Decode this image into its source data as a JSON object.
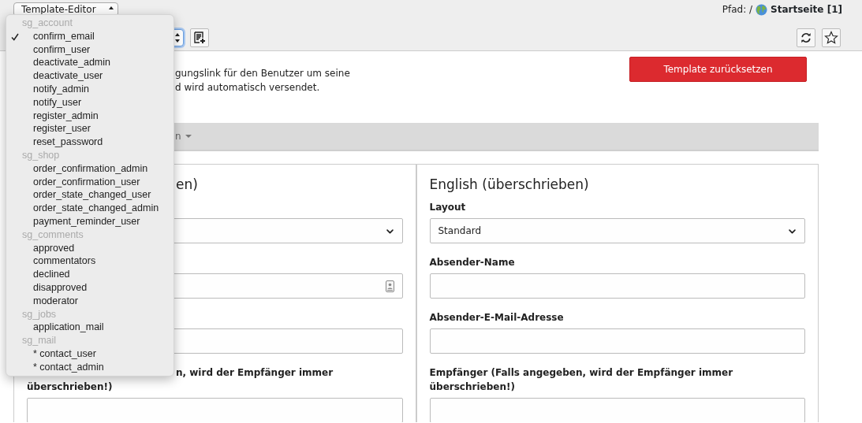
{
  "editor_select": {
    "value": "Template-Editor"
  },
  "path": {
    "label": "Pfad: /",
    "page": "Startseite [1]"
  },
  "reset_button": {
    "label": "Template zurücksetzen"
  },
  "description_lines": [
    "gungslink für den Benutzer um seine",
    "d wird automatisch versendet."
  ],
  "language_tab": {
    "label": "n"
  },
  "columns": [
    {
      "heading": "en)",
      "fields": [
        {
          "kind": "select"
        },
        {
          "kind": "picker"
        },
        {
          "kind": "text"
        },
        {
          "kind": "text",
          "label_lines": [
            "n, wird der Empfänger immer",
            "überschrieben!)"
          ]
        }
      ]
    },
    {
      "heading": "English (überschrieben)",
      "fields": [
        {
          "kind": "select",
          "label": "Layout",
          "value": "Standard"
        },
        {
          "kind": "text",
          "label": "Absender-Name"
        },
        {
          "kind": "text",
          "label": "Absender-E-Mail-Adresse"
        },
        {
          "kind": "text",
          "label": "Empfänger (Falls angegeben, wird der Empfänger immer überschrieben!)"
        }
      ]
    }
  ],
  "template_menu": {
    "groups": [
      {
        "label": "sg_account",
        "items": [
          {
            "label": "confirm_email",
            "selected": true
          },
          {
            "label": "confirm_user",
            "selected": false
          },
          {
            "label": "deactivate_admin",
            "selected": false
          },
          {
            "label": "deactivate_user",
            "selected": false
          },
          {
            "label": "notify_admin",
            "selected": false
          },
          {
            "label": "notify_user",
            "selected": false
          },
          {
            "label": "register_admin",
            "selected": false
          },
          {
            "label": "register_user",
            "selected": false
          },
          {
            "label": "reset_password",
            "selected": false
          }
        ]
      },
      {
        "label": "sg_shop",
        "items": [
          {
            "label": "order_confirmation_admin",
            "selected": false
          },
          {
            "label": "order_confirmation_user",
            "selected": false
          },
          {
            "label": "order_state_changed_user",
            "selected": false
          },
          {
            "label": "order_state_changed_admin",
            "selected": false
          },
          {
            "label": "payment_reminder_user",
            "selected": false
          }
        ]
      },
      {
        "label": "sg_comments",
        "items": [
          {
            "label": "approved",
            "selected": false
          },
          {
            "label": "commentators",
            "selected": false
          },
          {
            "label": "declined",
            "selected": false
          },
          {
            "label": "disapproved",
            "selected": false
          },
          {
            "label": "moderator",
            "selected": false
          }
        ]
      },
      {
        "label": "sg_jobs",
        "items": [
          {
            "label": "application_mail",
            "selected": false
          }
        ]
      },
      {
        "label": "sg_mail",
        "items": [
          {
            "label": "* contact_user",
            "selected": false
          },
          {
            "label": "* contact_admin",
            "selected": false
          }
        ]
      }
    ]
  }
}
